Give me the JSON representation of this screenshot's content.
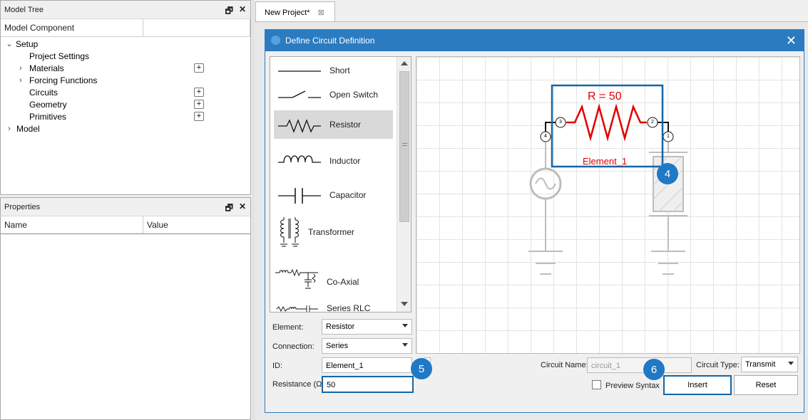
{
  "model_tree": {
    "title": "Model Tree",
    "column": "Model Component",
    "items": [
      {
        "label": "Setup"
      },
      {
        "label": "Project Settings"
      },
      {
        "label": "Materials"
      },
      {
        "label": "Forcing Functions"
      },
      {
        "label": "Circuits"
      },
      {
        "label": "Geometry"
      },
      {
        "label": "Primitives"
      },
      {
        "label": "Model"
      }
    ]
  },
  "properties": {
    "title": "Properties",
    "columns": [
      "Name",
      "Value"
    ]
  },
  "tab": {
    "label": "New Project*"
  },
  "dialog": {
    "title": "Define Circuit Definition",
    "palette": [
      "Short",
      "Open Switch",
      "Resistor",
      "Inductor",
      "Capacitor",
      "Transformer",
      "Co-Axial",
      "Series RLC"
    ],
    "selected_palette": "Resistor",
    "canvas": {
      "resistor_label": "R = 50",
      "element_label": "Element_1",
      "pins": [
        "3",
        "2",
        "4",
        "1"
      ]
    },
    "form": {
      "element_label": "Element:",
      "element_value": "Resistor",
      "connection_label": "Connection:",
      "connection_value": "Series",
      "id_label": "ID:",
      "id_value": "Element_1",
      "resistance_label": "Resistance (Ω):",
      "resistance_value": "50",
      "circuit_name_label": "Circuit Name:",
      "circuit_name_value": "circuit_1",
      "circuit_type_label": "Circuit Type:",
      "circuit_type_value": "Transmit",
      "preview_label": "Preview Syntax",
      "insert_label": "Insert",
      "reset_label": "Reset"
    },
    "badges": [
      "4",
      "5",
      "6"
    ]
  },
  "colors": {
    "accent": "#2b7bc0",
    "highlight": "#1565a6",
    "resistor": "#e00000"
  }
}
